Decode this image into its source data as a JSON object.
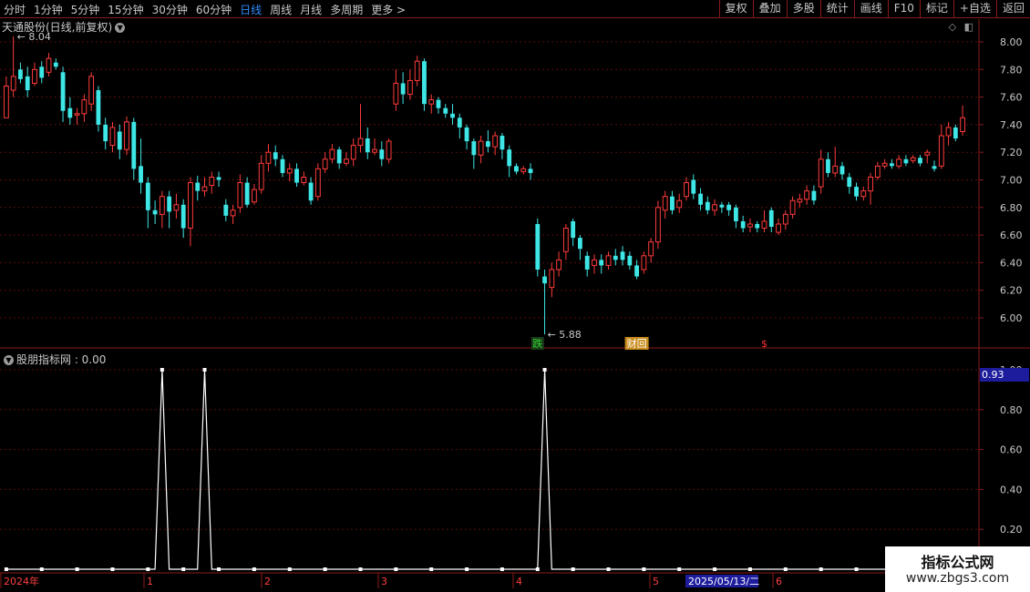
{
  "toolbar": {
    "periods": [
      "分时",
      "1分钟",
      "5分钟",
      "15分钟",
      "30分钟",
      "60分钟",
      "日线",
      "周线",
      "月线",
      "多周期",
      "更多 >"
    ],
    "active_period": "日线",
    "actions": [
      "复权",
      "叠加",
      "多股",
      "统计",
      "画线",
      "F10",
      "标记",
      "+自选",
      "返回"
    ]
  },
  "main_panel": {
    "title": "天通股份(日线,前复权)",
    "high_label": "8.04",
    "low_label": "5.88",
    "markers": [
      {
        "text": "跌",
        "color": "#2fd82f",
        "bg": "#1a3a1a"
      },
      {
        "text": "财回",
        "color": "#ffffff",
        "bg": "#c88a1a"
      },
      {
        "text": "$",
        "color": "#ff3030",
        "bg": ""
      }
    ],
    "y_ticks": [
      "8.00",
      "7.80",
      "7.60",
      "7.40",
      "7.20",
      "7.00",
      "6.80",
      "6.60",
      "6.40",
      "6.20",
      "6.00"
    ]
  },
  "indicator_panel": {
    "title": "股朋指标网 : 0.00",
    "current_value": "0.93",
    "y_ticks": [
      "1.00",
      "0.80",
      "0.60",
      "0.40",
      "0.20"
    ]
  },
  "date_axis": {
    "labels": [
      "2024年",
      "1",
      "2",
      "3",
      "4",
      "5",
      "6"
    ],
    "cursor_date": "2025/05/13/二"
  },
  "watermark": {
    "line1": "指标公式网",
    "line2": "www.zbgs3.com"
  },
  "colors": {
    "up": "#ff3b3b",
    "down": "#3ee6e6",
    "grid": "#5a0c0c",
    "axis": "#8b1a1a",
    "active": "#2f8cff"
  },
  "chart_data": {
    "type": "candlestick",
    "series_name": "天通股份",
    "ylim": [
      5.8,
      8.1
    ],
    "candles": [
      [
        7.45,
        7.68,
        7.45,
        7.75
      ],
      [
        7.65,
        7.75,
        7.6,
        8.04
      ],
      [
        7.8,
        7.73,
        7.7,
        7.85
      ],
      [
        7.75,
        7.65,
        7.6,
        7.82
      ],
      [
        7.7,
        7.8,
        7.68,
        7.85
      ],
      [
        7.82,
        7.74,
        7.7,
        7.86
      ],
      [
        7.78,
        7.88,
        7.75,
        7.92
      ],
      [
        7.85,
        7.82,
        7.8,
        7.88
      ],
      [
        7.78,
        7.5,
        7.42,
        7.82
      ],
      [
        7.52,
        7.45,
        7.4,
        7.6
      ],
      [
        7.47,
        7.48,
        7.4,
        7.52
      ],
      [
        7.48,
        7.58,
        7.42,
        7.62
      ],
      [
        7.55,
        7.75,
        7.5,
        7.78
      ],
      [
        7.65,
        7.4,
        7.35,
        7.68
      ],
      [
        7.4,
        7.28,
        7.22,
        7.45
      ],
      [
        7.25,
        7.38,
        7.2,
        7.42
      ],
      [
        7.35,
        7.22,
        7.15,
        7.4
      ],
      [
        7.22,
        7.42,
        7.18,
        7.46
      ],
      [
        7.42,
        7.08,
        7.0,
        7.45
      ],
      [
        7.1,
        6.98,
        6.9,
        7.3
      ],
      [
        6.98,
        6.78,
        6.65,
        7.02
      ],
      [
        6.78,
        6.75,
        6.68,
        6.85
      ],
      [
        6.75,
        6.88,
        6.65,
        6.92
      ],
      [
        6.88,
        6.77,
        6.65,
        6.92
      ],
      [
        6.78,
        6.82,
        6.72,
        6.9
      ],
      [
        6.82,
        6.65,
        6.58,
        6.86
      ],
      [
        6.65,
        6.98,
        6.52,
        7.02
      ],
      [
        6.98,
        6.92,
        6.85,
        7.03
      ],
      [
        6.92,
        6.95,
        6.88,
        7.02
      ],
      [
        6.96,
        7.02,
        6.9,
        7.06
      ],
      [
        7.02,
        7.0,
        6.95,
        7.06
      ],
      [
        6.82,
        6.74,
        6.7,
        6.86
      ],
      [
        6.74,
        6.78,
        6.68,
        6.82
      ],
      [
        6.8,
        6.98,
        6.76,
        7.04
      ],
      [
        6.98,
        6.82,
        6.8,
        7.02
      ],
      [
        6.84,
        6.93,
        6.82,
        6.97
      ],
      [
        6.93,
        7.12,
        6.9,
        7.18
      ],
      [
        7.12,
        7.2,
        7.06,
        7.26
      ],
      [
        7.2,
        7.15,
        7.1,
        7.25
      ],
      [
        7.15,
        7.05,
        7.02,
        7.18
      ],
      [
        7.05,
        7.08,
        6.99,
        7.12
      ],
      [
        7.08,
        6.98,
        6.95,
        7.12
      ],
      [
        6.98,
        7.02,
        6.96,
        7.06
      ],
      [
        6.98,
        6.85,
        6.82,
        7.02
      ],
      [
        6.88,
        7.08,
        6.85,
        7.12
      ],
      [
        7.08,
        7.15,
        7.05,
        7.2
      ],
      [
        7.15,
        7.22,
        7.12,
        7.26
      ],
      [
        7.22,
        7.12,
        7.08,
        7.24
      ],
      [
        7.12,
        7.15,
        7.1,
        7.2
      ],
      [
        7.15,
        7.25,
        7.1,
        7.3
      ],
      [
        7.25,
        7.3,
        7.2,
        7.55
      ],
      [
        7.3,
        7.2,
        7.15,
        7.38
      ],
      [
        7.2,
        7.22,
        7.18,
        7.3
      ],
      [
        7.22,
        7.15,
        7.1,
        7.28
      ],
      [
        7.15,
        7.28,
        7.12,
        7.3
      ],
      [
        7.55,
        7.7,
        7.5,
        7.8
      ],
      [
        7.7,
        7.62,
        7.55,
        7.78
      ],
      [
        7.62,
        7.72,
        7.58,
        7.8
      ],
      [
        7.72,
        7.86,
        7.68,
        7.9
      ],
      [
        7.86,
        7.55,
        7.5,
        7.88
      ],
      [
        7.55,
        7.58,
        7.48,
        7.62
      ],
      [
        7.58,
        7.52,
        7.48,
        7.6
      ],
      [
        7.52,
        7.48,
        7.45,
        7.55
      ],
      [
        7.48,
        7.45,
        7.4,
        7.55
      ],
      [
        7.45,
        7.38,
        7.3,
        7.48
      ],
      [
        7.38,
        7.28,
        7.22,
        7.4
      ],
      [
        7.28,
        7.18,
        7.08,
        7.3
      ],
      [
        7.18,
        7.28,
        7.12,
        7.32
      ],
      [
        7.28,
        7.24,
        7.2,
        7.36
      ],
      [
        7.24,
        7.32,
        7.18,
        7.35
      ],
      [
        7.32,
        7.22,
        7.15,
        7.34
      ],
      [
        7.22,
        7.1,
        7.02,
        7.25
      ],
      [
        7.1,
        7.06,
        7.04,
        7.12
      ],
      [
        7.06,
        7.08,
        7.04,
        7.1
      ],
      [
        7.08,
        7.05,
        7.0,
        7.12
      ],
      [
        6.68,
        6.35,
        6.3,
        6.72
      ],
      [
        6.3,
        6.25,
        5.88,
        6.35
      ],
      [
        6.22,
        6.35,
        6.15,
        6.4
      ],
      [
        6.35,
        6.42,
        6.3,
        6.48
      ],
      [
        6.48,
        6.65,
        6.42,
        6.68
      ],
      [
        6.7,
        6.58,
        6.52,
        6.72
      ],
      [
        6.58,
        6.5,
        6.42,
        6.6
      ],
      [
        6.45,
        6.35,
        6.3,
        6.48
      ],
      [
        6.38,
        6.42,
        6.32,
        6.46
      ],
      [
        6.42,
        6.38,
        6.32,
        6.46
      ],
      [
        6.38,
        6.45,
        6.35,
        6.48
      ],
      [
        6.45,
        6.42,
        6.38,
        6.5
      ],
      [
        6.48,
        6.42,
        6.38,
        6.52
      ],
      [
        6.45,
        6.38,
        6.35,
        6.48
      ],
      [
        6.38,
        6.3,
        6.28,
        6.42
      ],
      [
        6.35,
        6.45,
        6.32,
        6.48
      ],
      [
        6.45,
        6.55,
        6.4,
        6.58
      ],
      [
        6.55,
        6.8,
        6.5,
        6.85
      ],
      [
        6.78,
        6.88,
        6.72,
        6.92
      ],
      [
        6.88,
        6.78,
        6.75,
        6.92
      ],
      [
        6.8,
        6.85,
        6.76,
        6.9
      ],
      [
        6.88,
        6.98,
        6.85,
        7.02
      ],
      [
        7.0,
        6.9,
        6.86,
        7.04
      ],
      [
        6.9,
        6.82,
        6.78,
        6.94
      ],
      [
        6.84,
        6.78,
        6.75,
        6.88
      ],
      [
        6.78,
        6.82,
        6.74,
        6.86
      ],
      [
        6.82,
        6.8,
        6.76,
        6.84
      ],
      [
        6.82,
        6.78,
        6.74,
        6.84
      ],
      [
        6.8,
        6.7,
        6.65,
        6.82
      ],
      [
        6.7,
        6.65,
        6.62,
        6.74
      ],
      [
        6.66,
        6.68,
        6.62,
        6.72
      ],
      [
        6.68,
        6.65,
        6.62,
        6.7
      ],
      [
        6.65,
        6.7,
        6.62,
        6.78
      ],
      [
        6.78,
        6.66,
        6.62,
        6.8
      ],
      [
        6.62,
        6.68,
        6.6,
        6.72
      ],
      [
        6.68,
        6.75,
        6.64,
        6.78
      ],
      [
        6.75,
        6.85,
        6.72,
        6.88
      ],
      [
        6.84,
        6.86,
        6.8,
        6.9
      ],
      [
        6.86,
        6.92,
        6.82,
        6.96
      ],
      [
        6.92,
        6.85,
        6.82,
        6.96
      ],
      [
        6.95,
        7.15,
        6.9,
        7.22
      ],
      [
        7.15,
        7.05,
        7.02,
        7.2
      ],
      [
        7.05,
        7.1,
        7.02,
        7.24
      ],
      [
        7.1,
        7.04,
        7.0,
        7.13
      ],
      [
        7.02,
        6.95,
        6.9,
        7.05
      ],
      [
        6.95,
        6.88,
        6.85,
        6.98
      ],
      [
        6.88,
        6.92,
        6.85,
        6.95
      ],
      [
        6.92,
        7.02,
        6.82,
        7.05
      ],
      [
        7.02,
        7.1,
        7.0,
        7.13
      ],
      [
        7.1,
        7.12,
        7.08,
        7.15
      ],
      [
        7.12,
        7.1,
        7.08,
        7.15
      ],
      [
        7.1,
        7.15,
        7.08,
        7.18
      ],
      [
        7.15,
        7.12,
        7.1,
        7.18
      ],
      [
        7.14,
        7.16,
        7.12,
        7.18
      ],
      [
        7.16,
        7.12,
        7.1,
        7.18
      ],
      [
        7.18,
        7.2,
        7.12,
        7.22
      ],
      [
        7.1,
        7.08,
        7.06,
        7.14
      ],
      [
        7.1,
        7.32,
        7.08,
        7.4
      ],
      [
        7.32,
        7.38,
        7.25,
        7.42
      ],
      [
        7.38,
        7.3,
        7.28,
        7.4
      ],
      [
        7.35,
        7.45,
        7.32,
        7.54
      ]
    ],
    "indicator": {
      "name": "股朋指标网",
      "values": [
        0,
        0,
        0,
        0,
        0,
        0,
        0,
        0,
        0,
        0,
        0,
        0,
        0,
        0,
        0,
        0,
        0,
        0,
        0,
        0,
        0,
        0,
        1,
        0,
        0,
        0,
        0,
        0,
        1,
        0,
        0,
        0,
        0,
        0,
        0,
        0,
        0,
        0,
        0,
        0,
        0,
        0,
        0,
        0,
        0,
        0,
        0,
        0,
        0,
        0,
        0,
        0,
        0,
        0,
        0,
        0,
        0,
        0,
        0,
        0,
        0,
        0,
        0,
        0,
        0,
        0,
        0,
        0,
        0,
        0,
        0,
        0,
        0,
        0,
        0,
        0,
        1,
        0,
        0,
        0,
        0,
        0,
        0,
        0,
        0,
        0,
        0,
        0,
        0,
        0,
        0,
        0,
        0,
        0,
        0,
        0,
        0,
        0,
        0,
        0,
        0,
        0,
        0,
        0,
        0,
        0,
        0,
        0,
        0,
        0,
        0,
        0,
        0,
        0,
        0,
        0,
        0,
        0,
        0,
        0,
        0,
        0,
        0,
        0,
        0,
        0,
        0,
        0,
        0,
        0,
        0,
        0,
        0,
        0,
        0,
        0,
        0,
        0,
        0,
        0,
        0
      ],
      "ylim": [
        0,
        1.05
      ]
    }
  }
}
